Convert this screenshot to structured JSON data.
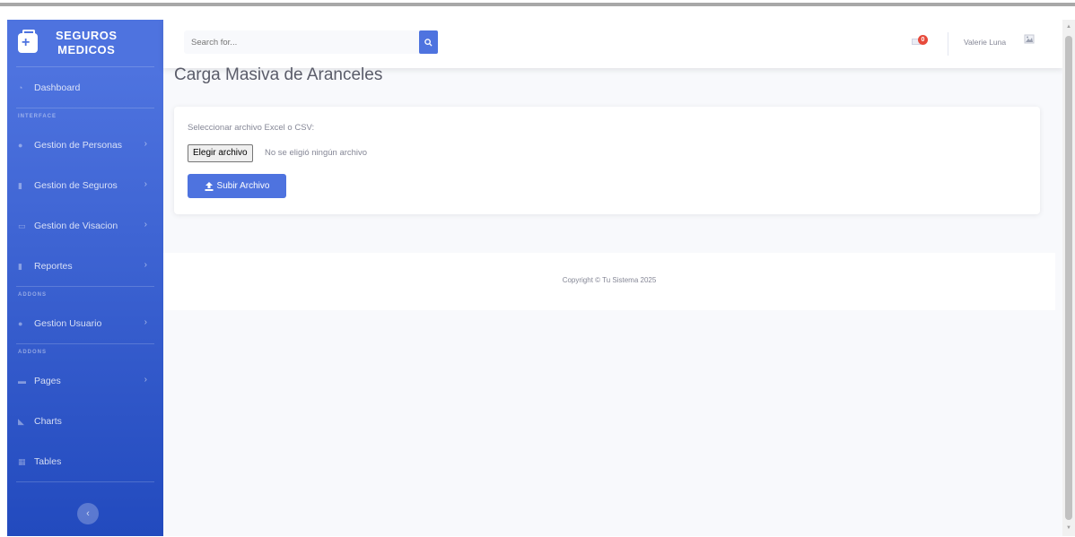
{
  "brand": {
    "line1": "SEGUROS",
    "line2": "MEDICOS",
    "icon": "medkit-icon"
  },
  "sidebar": {
    "items": [
      {
        "label": "Dashboard",
        "icon": "tachometer-icon",
        "chevron": false
      },
      {
        "heading": "INTERFACE"
      },
      {
        "label": "Gestion de Personas",
        "icon": "user-icon",
        "chevron": true
      },
      {
        "label": "Gestion de Seguros",
        "icon": "file-icon",
        "chevron": true
      },
      {
        "label": "Gestion de Visacion",
        "icon": "car-icon",
        "chevron": true
      },
      {
        "label": "Reportes",
        "icon": "file-alt-icon",
        "chevron": true
      },
      {
        "heading": "ADDONS"
      },
      {
        "label": "Gestion Usuario",
        "icon": "user-cog-icon",
        "chevron": true
      },
      {
        "heading": "ADDONS"
      },
      {
        "label": "Pages",
        "icon": "folder-icon",
        "chevron": true
      },
      {
        "label": "Charts",
        "icon": "chart-area-icon",
        "chevron": false
      },
      {
        "label": "Tables",
        "icon": "table-icon",
        "chevron": false
      }
    ],
    "labels": {
      "dashboard": "Dashboard",
      "interface": "INTERFACE",
      "personas": "Gestion de Personas",
      "seguros": "Gestion de Seguros",
      "visacion": "Gestion de Visacion",
      "reportes": "Reportes",
      "addons1": "ADDONS",
      "usuario": "Gestion Usuario",
      "addons2": "ADDONS",
      "pages": "Pages",
      "charts": "Charts",
      "tables": "Tables"
    }
  },
  "topbar": {
    "search_placeholder": "Search for...",
    "alerts_count": "0",
    "user_name": "Valerie Luna"
  },
  "main": {
    "title": "Carga Masiva de Aranceles",
    "file_label": "Seleccionar archivo Excel o CSV:",
    "file_button": "Elegir archivo",
    "file_status": "No se eligió ningún archivo",
    "upload_button": "Subir Archivo"
  },
  "footer": {
    "copyright": "Copyright © Tu Sistema 2025"
  },
  "colors": {
    "primary": "#4e73df",
    "primary_dark": "#224abe",
    "badge": "#e74a3b",
    "text_muted": "#858796",
    "background": "#f8f9fc"
  }
}
